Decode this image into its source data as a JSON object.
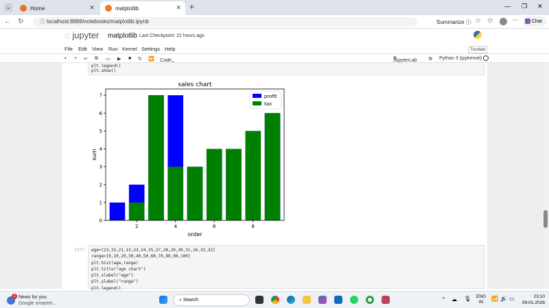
{
  "browser": {
    "tabs": [
      {
        "label": "Home",
        "active": false
      },
      {
        "label": "matplotlib",
        "active": true
      }
    ],
    "url": "localhost:8888/notebooks/matplotlib.ipynb",
    "summarize_label": "Summarize",
    "chat_label": "Chat"
  },
  "jupyter": {
    "logo_text": "jupyter",
    "notebook_name": "matplotlib",
    "checkpoint": "Last Checkpoint: 22 hours ago",
    "trusted": "Trusted",
    "menu": [
      "File",
      "Edit",
      "View",
      "Run",
      "Kernel",
      "Settings",
      "Help"
    ],
    "cell_type": "Code",
    "jupyterlab_label": "JupyterLab",
    "kernel": "Python 3 (ipykernel)"
  },
  "cell_top": {
    "lines": [
      "plt.legend()",
      "plt.show()"
    ]
  },
  "cell_bottom": {
    "prompt": "[37]:",
    "lines": [
      "age=[13,15,21,13,23,24,25,27,28,29,30,31,16,33,32]",
      "range=[0,10,20,30,40,50,60,70,80,90,100]",
      "plt.hist(age,range)",
      "plt.title(\"age chart\")",
      "plt.xlabel(\"age\")",
      "plt.ylabel(\"range\")",
      "plt.legend()"
    ]
  },
  "chart_data": {
    "type": "bar",
    "title": "sales chart",
    "xlabel": "order",
    "ylabel": "sum",
    "x": [
      1,
      2,
      3,
      4,
      5,
      6,
      7,
      8,
      9
    ],
    "series": [
      {
        "name": "profit",
        "values": [
          1,
          2,
          7,
          7,
          3,
          4,
          4,
          5,
          6
        ],
        "color": "#0000ff"
      },
      {
        "name": "tax",
        "values": [
          0,
          1,
          7,
          3,
          3,
          4,
          4,
          5,
          6
        ],
        "color": "#008000"
      }
    ],
    "xticks": [
      2,
      4,
      6,
      8
    ],
    "yticks": [
      0,
      1,
      2,
      3,
      4,
      5,
      6,
      7
    ],
    "xlim": [
      0.4,
      9.6
    ],
    "ylim": [
      0,
      7.35
    ],
    "legend": "top-right",
    "grid": false
  },
  "taskbar": {
    "news_title": "News for you",
    "news_sub": "Google smarten...",
    "news_badge": "1",
    "search_label": "Search",
    "lang": "ENG",
    "region": "IN",
    "time": "23:10",
    "date": "09-01-2026"
  }
}
